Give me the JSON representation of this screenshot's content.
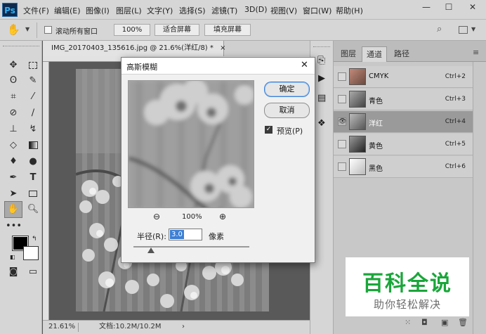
{
  "app": {
    "logo": "Ps"
  },
  "menu": [
    "文件(F)",
    "编辑(E)",
    "图像(I)",
    "图层(L)",
    "文字(Y)",
    "选择(S)",
    "滤镜(T)",
    "3D(D)",
    "视图(V)",
    "窗口(W)",
    "帮助(H)"
  ],
  "window_controls": {
    "minimize": "—",
    "maximize": "☐",
    "close": "✕"
  },
  "options_bar": {
    "scroll_all_label": "滚动所有窗口",
    "zoom_100": "100%",
    "fit_screen": "适合屏幕",
    "fill_screen": "填充屏幕"
  },
  "document": {
    "tab_title": "IMG_20170403_135616.jpg @ 21.6%(洋红/8) *",
    "tab_close": "×"
  },
  "status_bar": {
    "zoom": "21.61%",
    "doc_size": "文档:10.2M/10.2M",
    "arrow": "›"
  },
  "panel": {
    "tabs": [
      "图层",
      "通道",
      "路径"
    ],
    "active_tab": "通道",
    "channels": [
      {
        "name": "CMYK",
        "shortcut": "Ctrl+2",
        "selected": false,
        "visible": false
      },
      {
        "name": "青色",
        "shortcut": "Ctrl+3",
        "selected": false,
        "visible": false
      },
      {
        "name": "洋红",
        "shortcut": "Ctrl+4",
        "selected": true,
        "visible": true
      },
      {
        "name": "黄色",
        "shortcut": "Ctrl+5",
        "selected": false,
        "visible": false
      },
      {
        "name": "黑色",
        "shortcut": "Ctrl+6",
        "selected": false,
        "visible": false
      }
    ]
  },
  "dialog": {
    "title": "高斯模糊",
    "close": "✕",
    "ok_label": "确定",
    "cancel_label": "取消",
    "preview_label": "预览(P)",
    "preview_checked": true,
    "zoom_percent": "100%",
    "radius_label": "半径(R):",
    "radius_value": "3.0",
    "radius_unit": "像素"
  },
  "watermark": {
    "title": "百科全说",
    "subtitle": "助你轻松解决"
  },
  "colors": {
    "watermark_green": "#1aa63a",
    "selection_blue": "#3c7fd4",
    "ps_blue": "#34b0f5"
  }
}
